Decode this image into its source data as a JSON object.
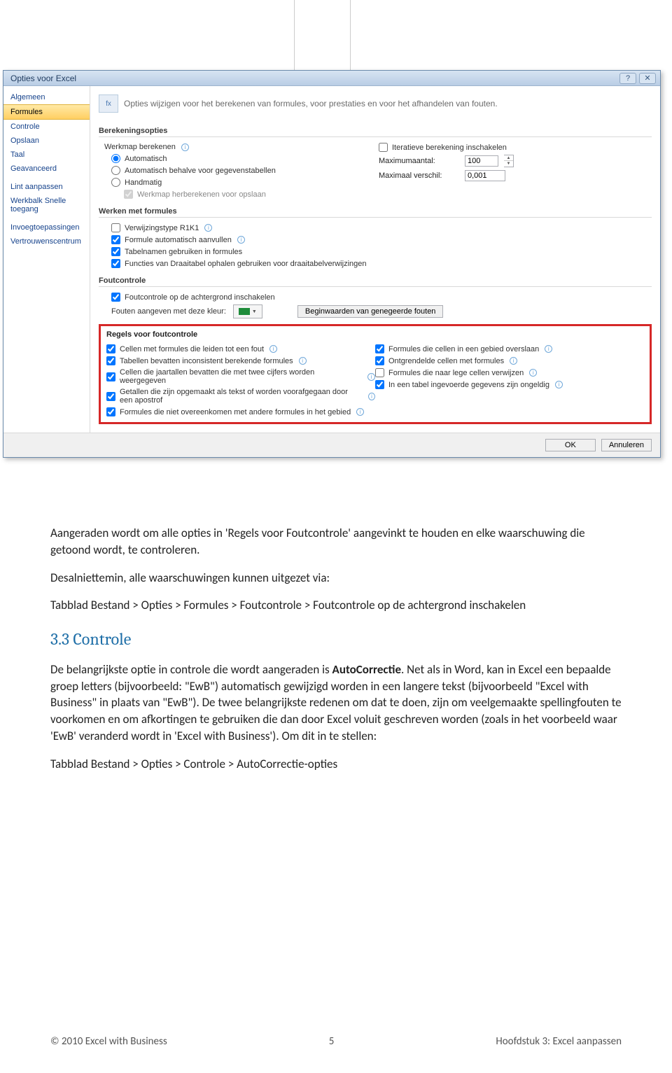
{
  "dialog": {
    "title": "Opties voor Excel",
    "sidebar": {
      "items": [
        {
          "label": "Algemeen"
        },
        {
          "label": "Formules"
        },
        {
          "label": "Controle"
        },
        {
          "label": "Opslaan"
        },
        {
          "label": "Taal"
        },
        {
          "label": "Geavanceerd"
        },
        {
          "label": "Lint aanpassen"
        },
        {
          "label": "Werkbalk Snelle toegang"
        },
        {
          "label": "Invoegtoepassingen"
        },
        {
          "label": "Vertrouwenscentrum"
        }
      ]
    },
    "pane": {
      "icon_text": "fx",
      "description": "Opties wijzigen voor het berekenen van formules, voor prestaties en voor het afhandelen van fouten.",
      "sections": {
        "calc": {
          "title": "Berekeningsopties",
          "group_label": "Werkmap berekenen",
          "radios": {
            "auto": "Automatisch",
            "auto_except": "Automatisch behalve voor gegevenstabellen",
            "manual": "Handmatig"
          },
          "recalc_on_save": "Werkmap herberekenen voor opslaan",
          "iterative": "Iteratieve berekening inschakelen",
          "max_iter_label": "Maximumaantal:",
          "max_iter_value": "100",
          "max_change_label": "Maximaal verschil:",
          "max_change_value": "0,001"
        },
        "formulas": {
          "title": "Werken met formules",
          "r1c1": "Verwijzingstype R1K1",
          "autocomplete": "Formule automatisch aanvullen",
          "tablenames": "Tabelnamen gebruiken in formules",
          "pivot": "Functies van Draaitabel ophalen gebruiken voor draaitabelverwijzingen"
        },
        "errcheck": {
          "title": "Foutcontrole",
          "bg_check": "Foutcontrole op de achtergrond inschakelen",
          "color_label": "Fouten aangeven met deze kleur:",
          "reset_button": "Beginwaarden van genegeerde fouten"
        },
        "rules": {
          "title": "Regels voor foutcontrole",
          "left": [
            {
              "label": "Cellen met formules die leiden tot een fout",
              "checked": true
            },
            {
              "label": "Tabellen bevatten inconsistent berekende formules",
              "checked": true
            },
            {
              "label": "Cellen die jaartallen bevatten die met twee cijfers worden weergegeven",
              "checked": true
            },
            {
              "label": "Getallen die zijn opgemaakt als tekst of worden voorafgegaan door een apostrof",
              "checked": true
            },
            {
              "label": "Formules die niet overeenkomen met andere formules in het gebied",
              "checked": true
            }
          ],
          "right": [
            {
              "label": "Formules die cellen in een gebied overslaan",
              "checked": true
            },
            {
              "label": "Ontgrendelde cellen met formules",
              "checked": true
            },
            {
              "label": "Formules die naar lege cellen verwijzen",
              "checked": false
            },
            {
              "label": "In een tabel ingevoerde gegevens zijn ongeldig",
              "checked": true
            }
          ]
        }
      }
    },
    "footer": {
      "ok": "OK",
      "cancel": "Annuleren"
    }
  },
  "doc": {
    "p1": "Aangeraden wordt om alle opties in 'Regels voor Foutcontrole' aangevinkt te houden en elke waarschuwing die getoond wordt, te controleren.",
    "p2_intro": "Desalniettemin, alle waarschuwingen kunnen uitgezet via:",
    "path1": "Tabblad Bestand > Opties > Formules > Foutcontrole > Foutcontrole op de achtergrond inschakelen",
    "h2": "3.3 Controle",
    "p3": "De belangrijkste optie in controle die wordt aangeraden is AutoCorrectie. Net als in Word, kan in Excel een bepaalde groep letters (bijvoorbeeld: \"EwB\") automatisch gewijzigd worden in een langere tekst (bijvoorbeeld \"Excel with Business\" in plaats van \"EwB\"). De twee belangrijkste redenen om dat te doen, zijn om veelgemaakte spellingfouten te voorkomen en om afkortingen te gebruiken die dan door Excel voluit geschreven worden (zoals in het voorbeeld waar 'EwB' veranderd wordt in 'Excel with Business'). Om dit in te stellen:",
    "path2": "Tabblad Bestand > Opties > Controle > AutoCorrectie-opties"
  },
  "footer": {
    "left": "© 2010 Excel with Business",
    "center": "5",
    "right": "Hoofdstuk 3: Excel aanpassen"
  }
}
